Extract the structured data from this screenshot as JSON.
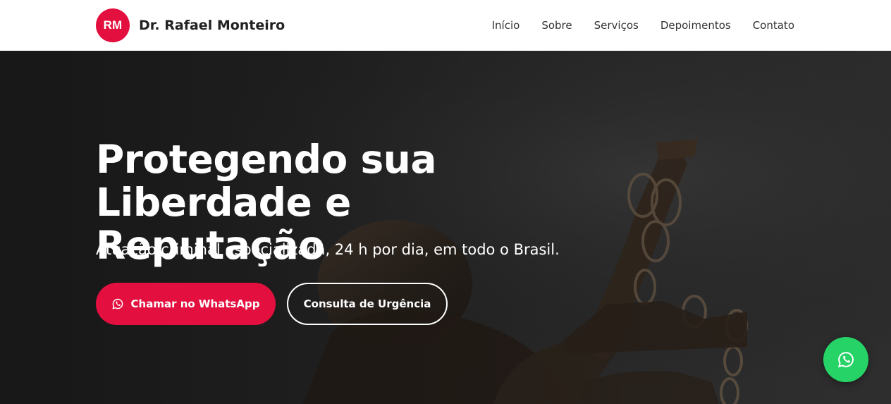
{
  "brand": {
    "initials": "RM",
    "name": "Dr. Rafael Monteiro",
    "color": "#e3103f"
  },
  "nav": {
    "items": [
      "Início",
      "Sobre",
      "Serviços",
      "Depoimentos",
      "Contato"
    ]
  },
  "hero": {
    "title_line1": "Protegendo sua",
    "title_line2": "Liberdade e Reputação",
    "subtitle": "Atuação criminal especializada, 24 h por dia, em todo o Brasil.",
    "primary_button": {
      "label": "Chamar no WhatsApp",
      "icon": "whatsapp-icon",
      "color": "#e3103f"
    },
    "secondary_button": {
      "label": "Consulta de Urgência"
    },
    "background_image": "justice-statue"
  },
  "floating_whatsapp": {
    "icon": "whatsapp-icon",
    "color": "#25d366"
  }
}
